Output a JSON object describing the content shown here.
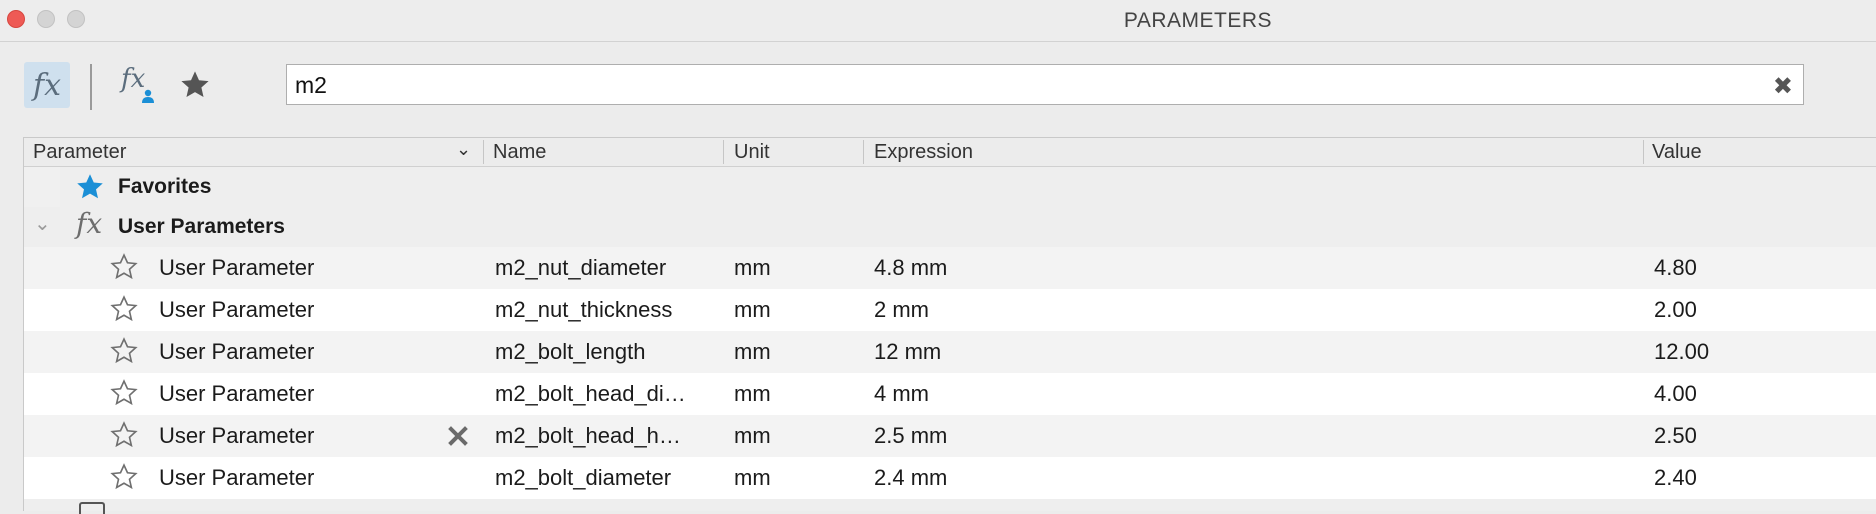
{
  "window": {
    "title": "PARAMETERS"
  },
  "toolbar": {
    "buttons": [
      {
        "icon": "fx-icon",
        "active": true
      },
      {
        "icon": "fx-user-icon",
        "active": false
      },
      {
        "icon": "star-filled-icon",
        "active": false
      }
    ],
    "search": {
      "value": "m2",
      "clear_icon": "✖"
    }
  },
  "table": {
    "columns": [
      "Parameter",
      "Name",
      "Unit",
      "Expression",
      "Value"
    ],
    "groups": [
      {
        "label": "Favorites",
        "icon": "star-blue-icon"
      },
      {
        "label": "User Parameters",
        "icon": "fx-icon"
      }
    ],
    "rows": [
      {
        "parameter": "User Parameter",
        "name": "m2_nut_diameter",
        "unit": "mm",
        "expression": "4.8 mm",
        "value": "4.80"
      },
      {
        "parameter": "User Parameter",
        "name": "m2_nut_thickness",
        "unit": "mm",
        "expression": "2 mm",
        "value": "2.00"
      },
      {
        "parameter": "User Parameter",
        "name": "m2_bolt_length",
        "unit": "mm",
        "expression": "12 mm",
        "value": "12.00"
      },
      {
        "parameter": "User Parameter",
        "name": "m2_bolt_head_di…",
        "unit": "mm",
        "expression": "4 mm",
        "value": "4.00"
      },
      {
        "parameter": "User Parameter",
        "name": "m2_bolt_head_h…",
        "unit": "mm",
        "expression": "2.5 mm",
        "value": "2.50"
      },
      {
        "parameter": "User Parameter",
        "name": "m2_bolt_diameter",
        "unit": "mm",
        "expression": "2.4 mm",
        "value": "2.40"
      }
    ]
  },
  "colors": {
    "accent_blue": "#1b8fd6",
    "active_button": "#cfe0ee",
    "close_button": "#ee5a55"
  }
}
